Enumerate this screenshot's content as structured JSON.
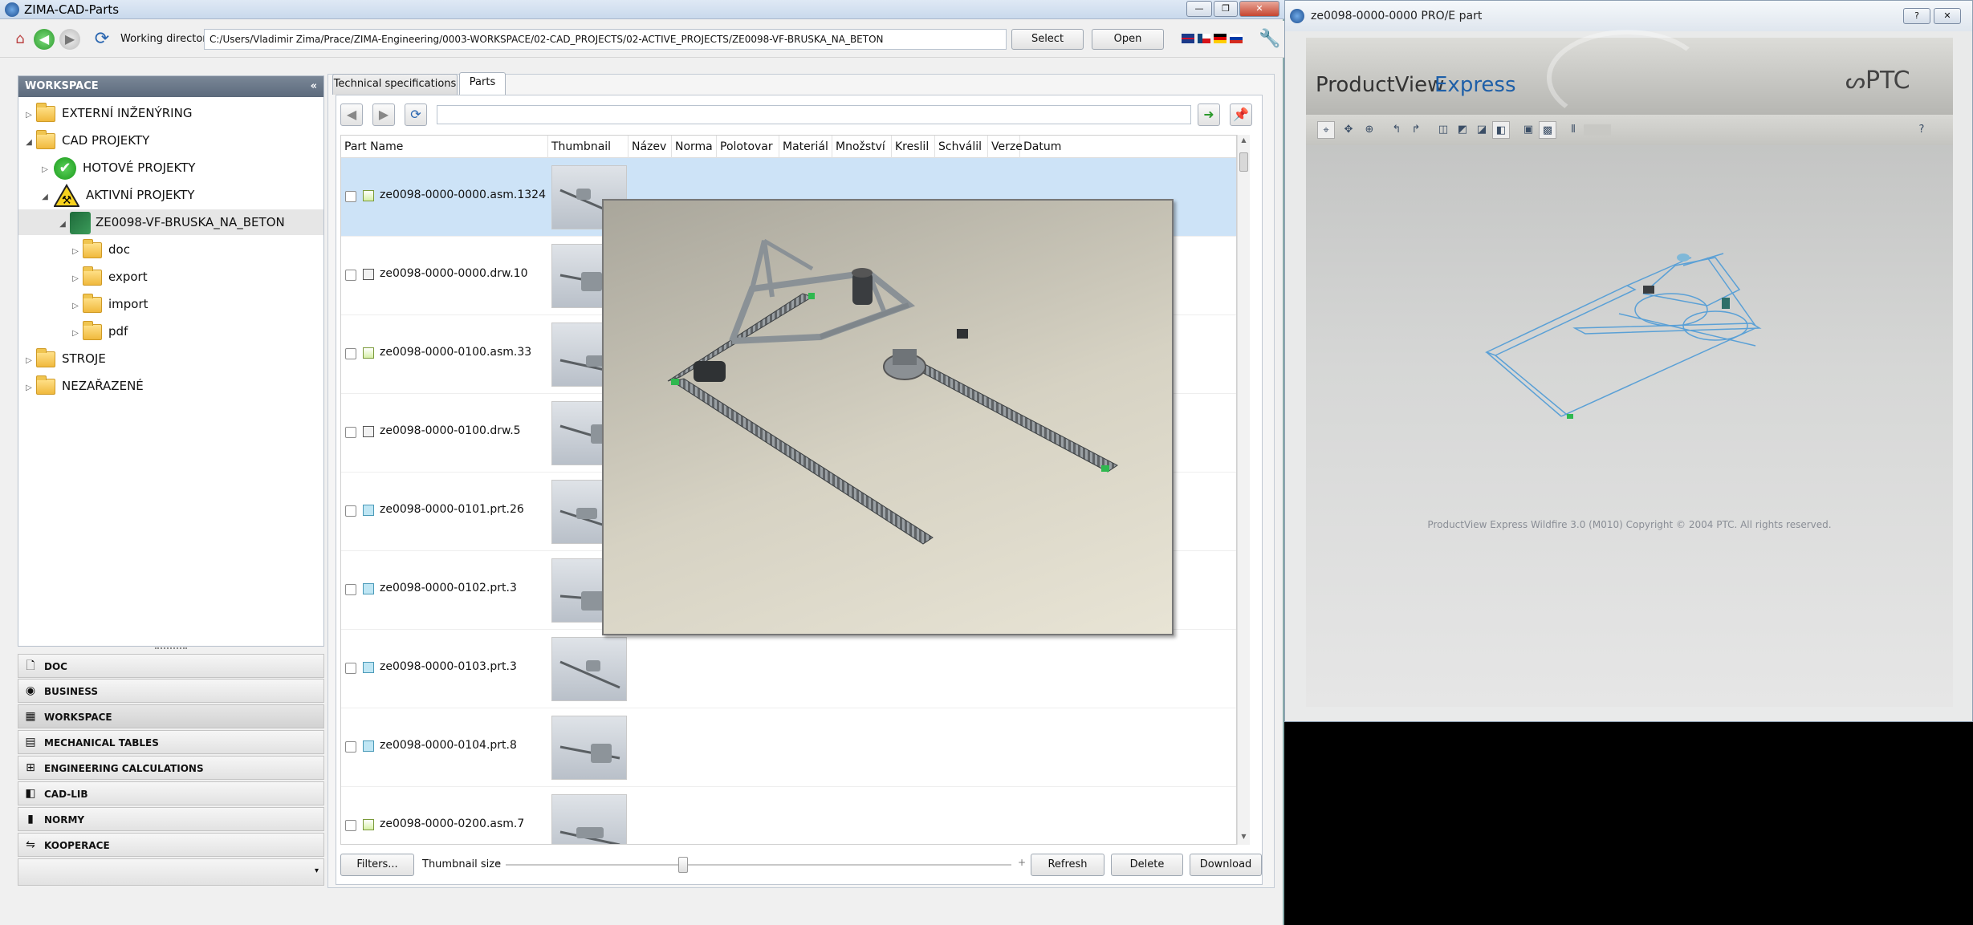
{
  "main_window": {
    "title": "ZIMA-CAD-Parts",
    "working_dir_label": "Working directory",
    "working_dir_value": "C:/Users/Vladimir Zima/Prace/ZIMA-Engineering/0003-WORKSPACE/02-CAD_PROJECTS/02-ACTIVE_PROJECTS/ZE0098-VF-BRUSKA_NA_BETON",
    "select_label": "Select",
    "open_label": "Open"
  },
  "workspace": {
    "header": "WORKSPACE",
    "collapse_glyph": "«",
    "tree": [
      {
        "label": "EXTERNÍ INŽENÝRING"
      },
      {
        "label": "CAD PROJEKTY"
      },
      {
        "label": "HOTOVÉ PROJEKTY"
      },
      {
        "label": "AKTIVNÍ PROJEKTY"
      },
      {
        "label": "ZE0098-VF-BRUSKA_NA_BETON"
      },
      {
        "label": "doc"
      },
      {
        "label": "export"
      },
      {
        "label": "import"
      },
      {
        "label": "pdf"
      },
      {
        "label": "STROJE"
      },
      {
        "label": "NEZAŘAZENÉ"
      }
    ]
  },
  "nav": {
    "items": [
      {
        "label": "DOC",
        "icon": "document-icon"
      },
      {
        "label": "BUSINESS",
        "icon": "business-icon"
      },
      {
        "label": "WORKSPACE",
        "icon": "workspace-icon"
      },
      {
        "label": "MECHANICAL TABLES",
        "icon": "table-icon"
      },
      {
        "label": "ENGINEERING CALCULATIONS",
        "icon": "calculator-icon"
      },
      {
        "label": "CAD-LIB",
        "icon": "cadlib-icon"
      },
      {
        "label": "NORMY",
        "icon": "book-icon"
      },
      {
        "label": "KOOPERACE",
        "icon": "cooperation-icon"
      }
    ]
  },
  "tabs": {
    "technical": "Technical specifications",
    "parts": "Parts"
  },
  "table": {
    "columns": [
      "Part Name",
      "Thumbnail",
      "Název",
      "Norma",
      "Polotovar",
      "Materiál",
      "Množství",
      "Kreslil",
      "Schválil",
      "Verze",
      "Datum"
    ],
    "rows": [
      {
        "name": "ze0098-0000-0000.asm.1324",
        "type": "asm"
      },
      {
        "name": "ze0098-0000-0000.drw.10",
        "type": "drw"
      },
      {
        "name": "ze0098-0000-0100.asm.33",
        "type": "asm"
      },
      {
        "name": "ze0098-0000-0100.drw.5",
        "type": "drw"
      },
      {
        "name": "ze0098-0000-0101.prt.26",
        "type": "prt"
      },
      {
        "name": "ze0098-0000-0102.prt.3",
        "type": "prt"
      },
      {
        "name": "ze0098-0000-0103.prt.3",
        "type": "prt"
      },
      {
        "name": "ze0098-0000-0104.prt.8",
        "type": "prt"
      },
      {
        "name": "ze0098-0000-0200.asm.7",
        "type": "asm"
      }
    ]
  },
  "bottom": {
    "filters": "Filters...",
    "thumb_size_label": "Thumbnail size",
    "minus": "-",
    "plus": "+",
    "thumb_size_value": 0.35,
    "refresh": "Refresh",
    "delete": "Delete",
    "download": "Download"
  },
  "viewer": {
    "title": "ze0098-0000-0000 PRO/E part",
    "brand_product": "ProductView",
    "brand_express": "Express",
    "brand_ptc": "PTC",
    "copyright": "ProductView Express Wildfire 3.0 (M010) Copyright © 2004 PTC.  All rights reserved."
  },
  "colors": {
    "selection": "#cde3f7",
    "header_bar": "#5c6a7c",
    "accent_blue": "#1e5fa8"
  }
}
